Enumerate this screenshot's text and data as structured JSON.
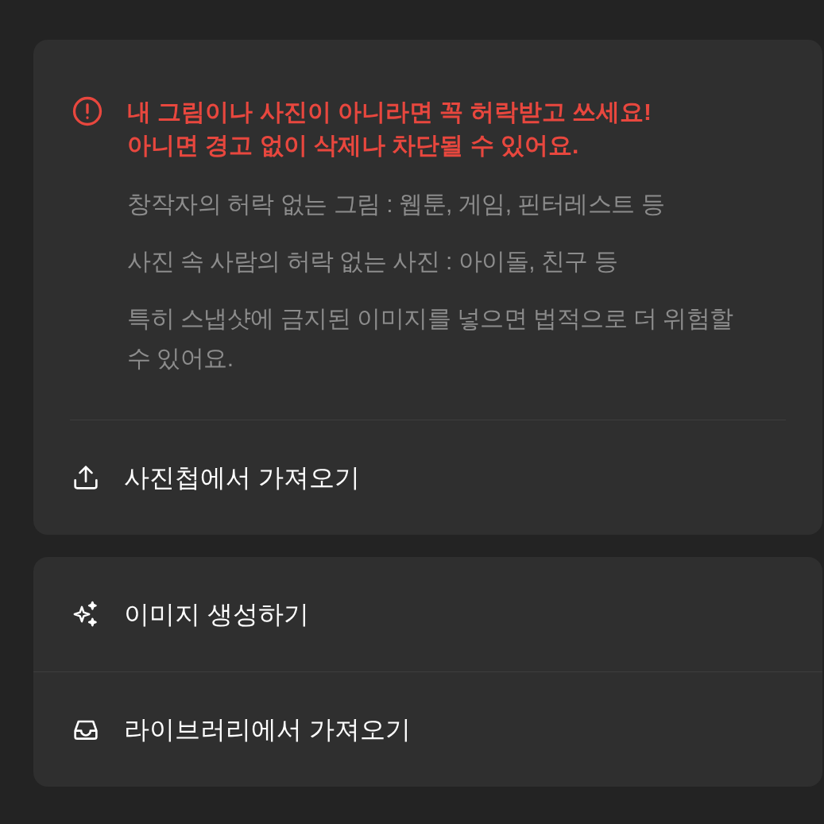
{
  "warning": {
    "title_lines": [
      "내 그림이나 사진이 아니라면 꼭 허락받고 쓰세요!",
      "아니면 경고 없이 삭제나 차단될 수 있어요."
    ],
    "details": [
      "창작자의 허락 없는 그림 : 웹툰, 게임, 핀터레스트 등",
      "사진 속 사람의 허락 없는 사진 : 아이돌, 친구 등",
      "특히 스냅샷에 금지된 이미지를 넣으면 법적으로 더 위험할 수 있어요."
    ]
  },
  "upload_action": {
    "kind": "upload",
    "label": "사진첩에서 가져오기"
  },
  "actions": [
    {
      "kind": "generate",
      "label": "이미지 생성하기"
    },
    {
      "kind": "library",
      "label": "라이브러리에서 가져오기"
    }
  ]
}
